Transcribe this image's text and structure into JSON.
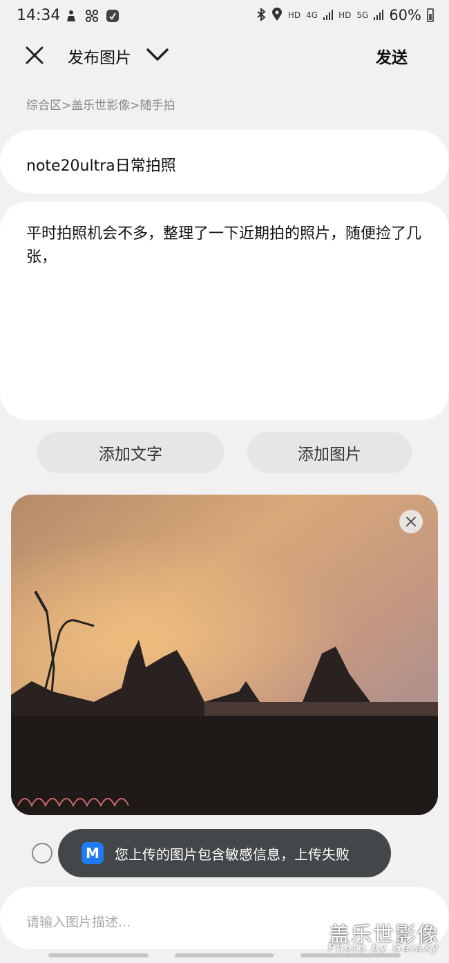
{
  "status_bar": {
    "time": "14:34",
    "left_icons": [
      "person-icon",
      "fan-icon",
      "app-icon"
    ],
    "right_icons": [
      "bluetooth-icon",
      "location-icon"
    ],
    "hd1": "HD",
    "net1": "4G",
    "hd2": "HD",
    "net2": "5G",
    "battery": "60%"
  },
  "header": {
    "title": "发布图片",
    "send_label": "发送",
    "breadcrumb": "综合区>盖乐世影像>随手拍"
  },
  "post": {
    "title": "note20ultra日常拍照",
    "body": "平时拍照机会不多，整理了一下近期拍的照片，随便捡了几张，"
  },
  "actions": {
    "add_text": "添加文字",
    "add_image": "添加图片"
  },
  "toast": {
    "icon_letter": "M",
    "message": "您上传的图片包含敏感信息，上传失败"
  },
  "description": {
    "placeholder": "请输入图片描述..."
  },
  "watermark": {
    "main": "盖乐世影像",
    "sub": "Photo by Galaxy"
  },
  "colors": {
    "background": "#f1f1f1",
    "toast_bg": "#444749",
    "toast_icon": "#1f7bf2"
  }
}
